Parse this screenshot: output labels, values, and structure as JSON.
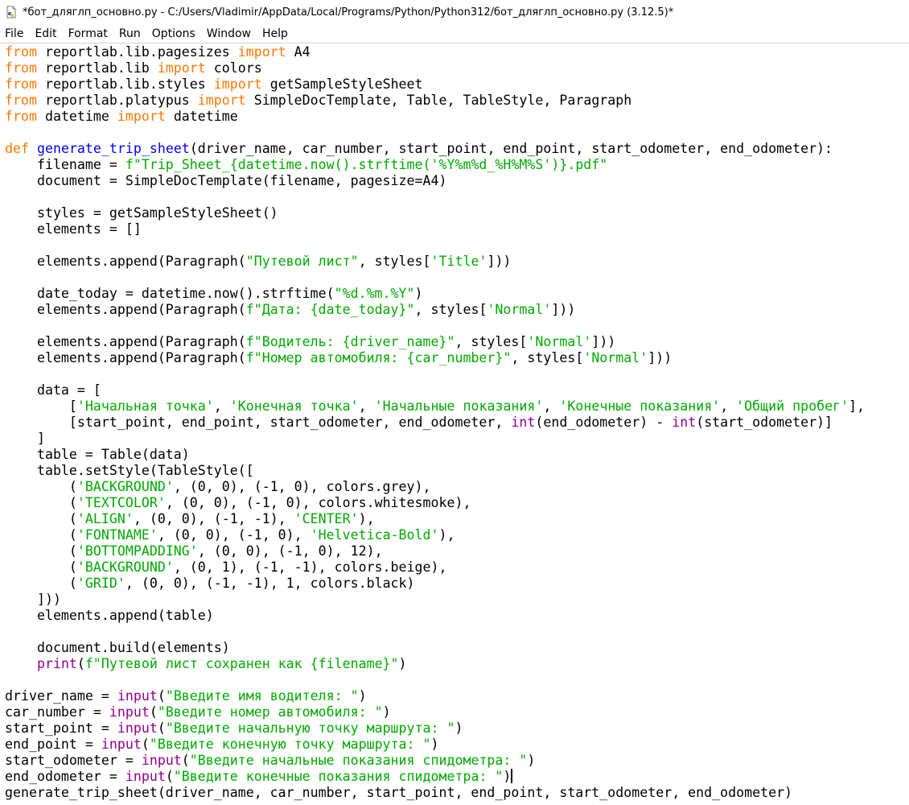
{
  "window": {
    "title": "*бот_дляглп_основно.py - C:/Users/Vladimir/AppData/Local/Programs/Python/Python312/бот_дляглп_основно.py (3.12.5)*"
  },
  "menu": [
    {
      "label": "File"
    },
    {
      "label": "Edit"
    },
    {
      "label": "Format"
    },
    {
      "label": "Run"
    },
    {
      "label": "Options"
    },
    {
      "label": "Window"
    },
    {
      "label": "Help"
    }
  ],
  "colors": {
    "keyword": "#ff7700",
    "definition": "#0000ff",
    "string": "#00aa00",
    "builtin": "#900090",
    "default": "#000000"
  },
  "icons": {
    "app": "python-file-icon"
  },
  "code_lines": [
    [
      {
        "t": "from",
        "c": "kw"
      },
      {
        "t": " reportlab.lib.pagesizes "
      },
      {
        "t": "import",
        "c": "kw"
      },
      {
        "t": " A4"
      }
    ],
    [
      {
        "t": "from",
        "c": "kw"
      },
      {
        "t": " reportlab.lib "
      },
      {
        "t": "import",
        "c": "kw"
      },
      {
        "t": " colors"
      }
    ],
    [
      {
        "t": "from",
        "c": "kw"
      },
      {
        "t": " reportlab.lib.styles "
      },
      {
        "t": "import",
        "c": "kw"
      },
      {
        "t": " getSampleStyleSheet"
      }
    ],
    [
      {
        "t": "from",
        "c": "kw"
      },
      {
        "t": " reportlab.platypus "
      },
      {
        "t": "import",
        "c": "kw"
      },
      {
        "t": " SimpleDocTemplate, Table, TableStyle, Paragraph"
      }
    ],
    [
      {
        "t": "from",
        "c": "kw"
      },
      {
        "t": " datetime "
      },
      {
        "t": "import",
        "c": "kw"
      },
      {
        "t": " datetime"
      }
    ],
    [],
    [
      {
        "t": "def",
        "c": "kw"
      },
      {
        "t": " "
      },
      {
        "t": "generate_trip_sheet",
        "c": "def"
      },
      {
        "t": "(driver_name, car_number, start_point, end_point, start_odometer, end_odometer):"
      }
    ],
    [
      {
        "t": "    filename = "
      },
      {
        "t": "f\"Trip_Sheet_{datetime.now().strftime('%Y%m%d_%H%M%S')}.pdf\"",
        "c": "str"
      }
    ],
    [
      {
        "t": "    document = SimpleDocTemplate(filename, pagesize=A4)"
      }
    ],
    [],
    [
      {
        "t": "    styles = getSampleStyleSheet()"
      }
    ],
    [
      {
        "t": "    elements = []"
      }
    ],
    [],
    [
      {
        "t": "    elements.append(Paragraph("
      },
      {
        "t": "\"Путевой лист\"",
        "c": "str"
      },
      {
        "t": ", styles["
      },
      {
        "t": "'Title'",
        "c": "str"
      },
      {
        "t": "]))"
      }
    ],
    [],
    [
      {
        "t": "    date_today = datetime.now().strftime("
      },
      {
        "t": "\"%d.%m.%Y\"",
        "c": "str"
      },
      {
        "t": ")"
      }
    ],
    [
      {
        "t": "    elements.append(Paragraph("
      },
      {
        "t": "f\"Дата: {date_today}\"",
        "c": "str"
      },
      {
        "t": ", styles["
      },
      {
        "t": "'Normal'",
        "c": "str"
      },
      {
        "t": "]))"
      }
    ],
    [],
    [
      {
        "t": "    elements.append(Paragraph("
      },
      {
        "t": "f\"Водитель: {driver_name}\"",
        "c": "str"
      },
      {
        "t": ", styles["
      },
      {
        "t": "'Normal'",
        "c": "str"
      },
      {
        "t": "]))"
      }
    ],
    [
      {
        "t": "    elements.append(Paragraph("
      },
      {
        "t": "f\"Номер автомобиля: {car_number}\"",
        "c": "str"
      },
      {
        "t": ", styles["
      },
      {
        "t": "'Normal'",
        "c": "str"
      },
      {
        "t": "]))"
      }
    ],
    [],
    [
      {
        "t": "    data = ["
      }
    ],
    [
      {
        "t": "        ["
      },
      {
        "t": "'Начальная точка'",
        "c": "str"
      },
      {
        "t": ", "
      },
      {
        "t": "'Конечная точка'",
        "c": "str"
      },
      {
        "t": ", "
      },
      {
        "t": "'Начальные показания'",
        "c": "str"
      },
      {
        "t": ", "
      },
      {
        "t": "'Конечные показания'",
        "c": "str"
      },
      {
        "t": ", "
      },
      {
        "t": "'Общий пробег'",
        "c": "str"
      },
      {
        "t": "],"
      }
    ],
    [
      {
        "t": "        [start_point, end_point, start_odometer, end_odometer, "
      },
      {
        "t": "int",
        "c": "bi"
      },
      {
        "t": "(end_odometer) - "
      },
      {
        "t": "int",
        "c": "bi"
      },
      {
        "t": "(start_odometer)]"
      }
    ],
    [
      {
        "t": "    ]"
      }
    ],
    [
      {
        "t": "    table = Table(data)"
      }
    ],
    [
      {
        "t": "    table.setStyle(TableStyle(["
      }
    ],
    [
      {
        "t": "        ("
      },
      {
        "t": "'BACKGROUND'",
        "c": "str"
      },
      {
        "t": ", (0, 0), (-1, 0), colors.grey),"
      }
    ],
    [
      {
        "t": "        ("
      },
      {
        "t": "'TEXTCOLOR'",
        "c": "str"
      },
      {
        "t": ", (0, 0), (-1, 0), colors.whitesmoke),"
      }
    ],
    [
      {
        "t": "        ("
      },
      {
        "t": "'ALIGN'",
        "c": "str"
      },
      {
        "t": ", (0, 0), (-1, -1), "
      },
      {
        "t": "'CENTER'",
        "c": "str"
      },
      {
        "t": "),"
      }
    ],
    [
      {
        "t": "        ("
      },
      {
        "t": "'FONTNAME'",
        "c": "str"
      },
      {
        "t": ", (0, 0), (-1, 0), "
      },
      {
        "t": "'Helvetica-Bold'",
        "c": "str"
      },
      {
        "t": "),"
      }
    ],
    [
      {
        "t": "        ("
      },
      {
        "t": "'BOTTOMPADDING'",
        "c": "str"
      },
      {
        "t": ", (0, 0), (-1, 0), 12),"
      }
    ],
    [
      {
        "t": "        ("
      },
      {
        "t": "'BACKGROUND'",
        "c": "str"
      },
      {
        "t": ", (0, 1), (-1, -1), colors.beige),"
      }
    ],
    [
      {
        "t": "        ("
      },
      {
        "t": "'GRID'",
        "c": "str"
      },
      {
        "t": ", (0, 0), (-1, -1), 1, colors.black)"
      }
    ],
    [
      {
        "t": "    ]))"
      }
    ],
    [
      {
        "t": "    elements.append(table)"
      }
    ],
    [],
    [
      {
        "t": "    document.build(elements)"
      }
    ],
    [
      {
        "t": "    "
      },
      {
        "t": "print",
        "c": "bi"
      },
      {
        "t": "("
      },
      {
        "t": "f\"Путевой лист сохранен как {filename}\"",
        "c": "str"
      },
      {
        "t": ")"
      }
    ],
    [],
    [
      {
        "t": "driver_name = "
      },
      {
        "t": "input",
        "c": "bi"
      },
      {
        "t": "("
      },
      {
        "t": "\"Введите имя водителя: \"",
        "c": "str"
      },
      {
        "t": ")"
      }
    ],
    [
      {
        "t": "car_number = "
      },
      {
        "t": "input",
        "c": "bi"
      },
      {
        "t": "("
      },
      {
        "t": "\"Введите номер автомобиля: \"",
        "c": "str"
      },
      {
        "t": ")"
      }
    ],
    [
      {
        "t": "start_point = "
      },
      {
        "t": "input",
        "c": "bi"
      },
      {
        "t": "("
      },
      {
        "t": "\"Введите начальную точку маршрута: \"",
        "c": "str"
      },
      {
        "t": ")"
      }
    ],
    [
      {
        "t": "end_point = "
      },
      {
        "t": "input",
        "c": "bi"
      },
      {
        "t": "("
      },
      {
        "t": "\"Введите конечную точку маршрута: \"",
        "c": "str"
      },
      {
        "t": ")"
      }
    ],
    [
      {
        "t": "start_odometer = "
      },
      {
        "t": "input",
        "c": "bi"
      },
      {
        "t": "("
      },
      {
        "t": "\"Введите начальные показания спидометра: \"",
        "c": "str"
      },
      {
        "t": ")"
      }
    ],
    [
      {
        "t": "end_odometer = "
      },
      {
        "t": "input",
        "c": "bi"
      },
      {
        "t": "("
      },
      {
        "t": "\"Введите конечные показания спидометра: \"",
        "c": "str"
      },
      {
        "t": ")"
      },
      {
        "caret": true
      }
    ],
    [
      {
        "t": "generate_trip_sheet(driver_name, car_number, start_point, end_point, start_odometer, end_odometer)"
      }
    ]
  ]
}
